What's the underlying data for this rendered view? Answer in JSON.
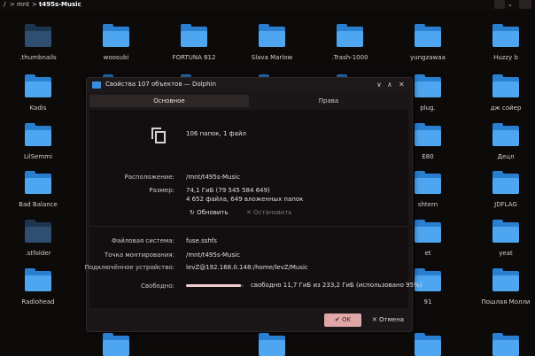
{
  "pathbar": {
    "root": "/",
    "sep1": ">",
    "crumb1": "mnt",
    "sep2": ">",
    "crumb2": "t495s-Music"
  },
  "files": [
    {
      "name": ".thumbnails",
      "style": "dark"
    },
    {
      "name": "woosubi",
      "style": "blue"
    },
    {
      "name": "FORTUNA 812",
      "style": "blue"
    },
    {
      "name": "Slava Marlow",
      "style": "blue"
    },
    {
      "name": ".Trash-1000",
      "style": "blue"
    },
    {
      "name": "yungzawaa",
      "style": "blue"
    },
    {
      "name": "Huzzy b",
      "style": "blue"
    },
    {
      "name": "Kadis",
      "style": "blue"
    },
    {
      "name": "",
      "style": "blue"
    },
    {
      "name": "",
      "style": "blue"
    },
    {
      "name": "",
      "style": "blue"
    },
    {
      "name": "",
      "style": "blue"
    },
    {
      "name": "plug.",
      "style": "blue"
    },
    {
      "name": "дж сойер",
      "style": "blue"
    },
    {
      "name": "LilSemmi",
      "style": "blue"
    },
    {
      "name": "",
      "style": "blue"
    },
    {
      "name": "",
      "style": "blue"
    },
    {
      "name": "",
      "style": "blue"
    },
    {
      "name": "",
      "style": "blue"
    },
    {
      "name": "E80",
      "style": "blue"
    },
    {
      "name": "Децл",
      "style": "blue"
    },
    {
      "name": "Bad Balance",
      "style": "blue"
    },
    {
      "name": "",
      "style": "blue"
    },
    {
      "name": "",
      "style": "blue"
    },
    {
      "name": "",
      "style": "blue"
    },
    {
      "name": "",
      "style": "blue"
    },
    {
      "name": "shtern",
      "style": "blue"
    },
    {
      "name": "JDFLAG",
      "style": "blue"
    },
    {
      "name": ".stfolder",
      "style": "dark"
    },
    {
      "name": "",
      "style": "blue"
    },
    {
      "name": "",
      "style": "blue"
    },
    {
      "name": "",
      "style": "blue"
    },
    {
      "name": "",
      "style": "blue"
    },
    {
      "name": "et",
      "style": "blue"
    },
    {
      "name": "yeat",
      "style": "blue"
    },
    {
      "name": "Radiohead",
      "style": "blue"
    },
    {
      "name": "",
      "style": "blue"
    },
    {
      "name": "",
      "style": "blue"
    },
    {
      "name": "",
      "style": "blue"
    },
    {
      "name": "",
      "style": "blue"
    },
    {
      "name": "91",
      "style": "blue"
    },
    {
      "name": "Пошлая Молли",
      "style": "blue"
    }
  ],
  "dialog": {
    "title": "Свойства 107 объектов — Dolphin",
    "win_min": "∨",
    "win_max": "∧",
    "win_close": "✕",
    "tab_basic": "Основное",
    "tab_rights": "Права",
    "summary": "106 папок, 1 файл",
    "location_label": "Расположение:",
    "location_value": "/mnt/t495s-Music",
    "size_label": "Размер:",
    "size_value": "74,1 ГиБ (79 545 584 649)",
    "size_detail": "4 652 файла, 649 вложенных папок",
    "refresh_label": "Обновить",
    "stop_label": "Остановить",
    "fs_label": "Файловая система:",
    "fs_value": "fuse.sshfs",
    "mount_label": "Точка монтирования:",
    "mount_value": "/mnt/t495s-Music",
    "device_label": "Подключённое устройство:",
    "device_value": "levZ@192.168.0.148:/home/levZ/Music",
    "free_label": "Свободно:",
    "free_value": "свободно 11,7 ГиБ из 233,2 ГиБ (использовано 95%)",
    "used_fraction": 0.95,
    "ok_label": "OK",
    "cancel_label": "Отмена"
  },
  "colors": {
    "accent": "#e0a7a9",
    "folder_blue": "#4ea6f0",
    "folder_dark": "#2f4e70"
  }
}
